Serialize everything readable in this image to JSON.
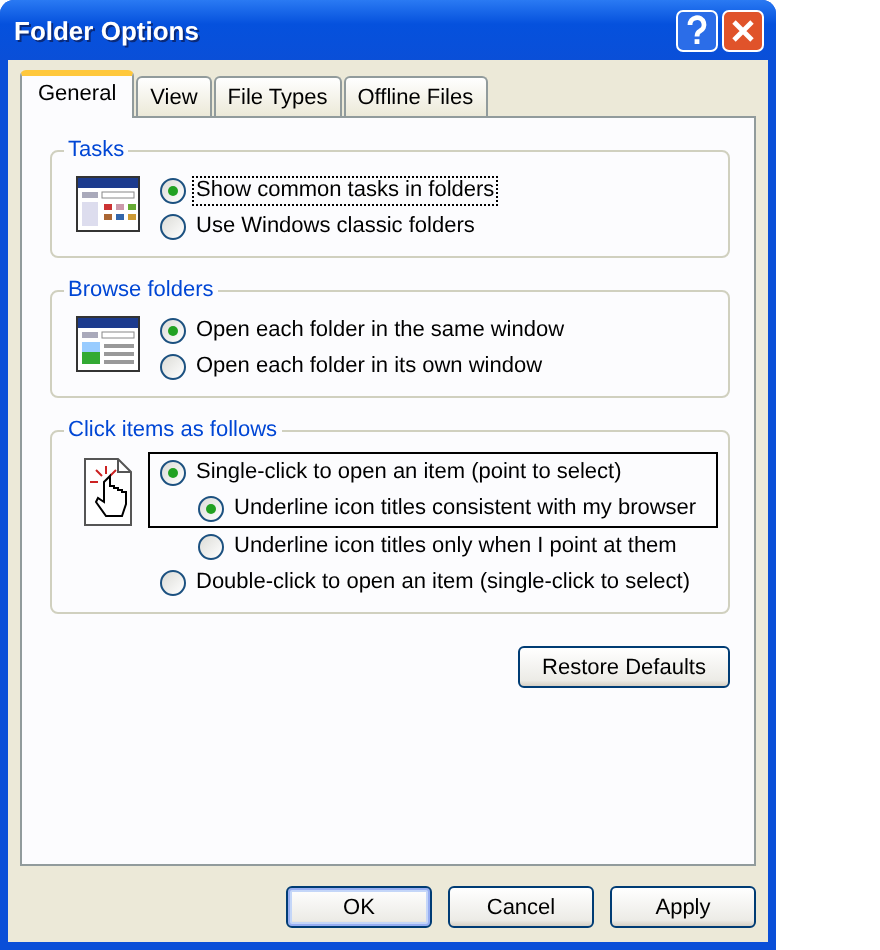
{
  "window": {
    "title": "Folder Options"
  },
  "tabs": [
    {
      "label": "General",
      "selected": true
    },
    {
      "label": "View",
      "selected": false
    },
    {
      "label": "File Types",
      "selected": false
    },
    {
      "label": "Offline Files",
      "selected": false
    }
  ],
  "groups": [
    {
      "title": "Tasks",
      "kind": "tasks",
      "options": [
        {
          "label": "Show common tasks in folders",
          "selected": true,
          "focused": true,
          "framed": false
        },
        {
          "label": "Use Windows classic folders",
          "selected": false,
          "focused": false,
          "framed": false
        }
      ]
    },
    {
      "title": "Browse folders",
      "kind": "browse",
      "options": [
        {
          "label": "Open each folder in the same window",
          "selected": true,
          "focused": false,
          "framed": false
        },
        {
          "label": "Open each folder in its own window",
          "selected": false,
          "focused": false,
          "framed": false
        }
      ]
    },
    {
      "title": "Click items as follows",
      "kind": "click",
      "options": [
        {
          "label": "Single-click to open an item (point to select)",
          "selected": true,
          "focused": false,
          "framed": true,
          "children": [
            {
              "label": "Underline icon titles consistent with my browser",
              "selected": true,
              "focused": false,
              "framed": true
            },
            {
              "label": "Underline icon titles only when I point at them",
              "selected": false,
              "focused": false,
              "framed": false
            }
          ]
        },
        {
          "label": "Double-click to open an item (single-click to select)",
          "selected": false,
          "focused": false,
          "framed": false
        }
      ]
    }
  ],
  "restore_button": {
    "label": "Restore Defaults"
  },
  "buttons": [
    {
      "label": "OK",
      "default": true
    },
    {
      "label": "Cancel",
      "default": false
    },
    {
      "label": "Apply",
      "default": false
    }
  ]
}
